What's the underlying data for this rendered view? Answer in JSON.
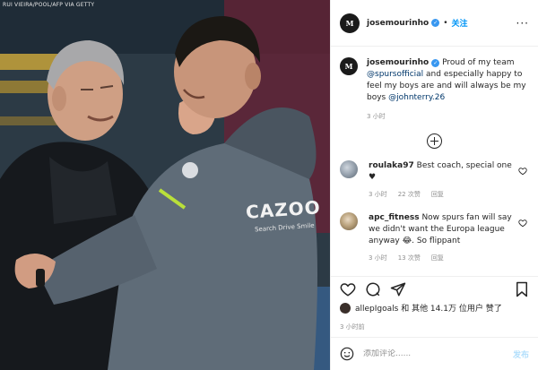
{
  "photo": {
    "credit": "RUI VIEIRA/POOL/AFP VIA GETTY",
    "jacket_brand": "CAZOO",
    "jacket_tagline": "Search Drive Smile"
  },
  "header": {
    "avatar_text": "M",
    "username": "josemourinho",
    "follow_label": "关注",
    "more_label": "···"
  },
  "caption": {
    "username": "josemourinho",
    "text_1": "Proud of my team",
    "mention_1": "@spursofficial",
    "text_2": "and especially happy to feel my boys are and will always be my boys",
    "mention_2": "@johnterry.26",
    "time": "3 小时"
  },
  "comments": [
    {
      "username": "roulaka97",
      "text": "Best coach, special one ♥",
      "time": "3 小时",
      "likes": "22 次赞",
      "reply": "回复"
    },
    {
      "username": "apc_fitness",
      "text": "Now spurs fan will say we didn't want the Europa league anyway 😂. So flippant",
      "time": "3 小时",
      "likes": "13 次赞",
      "reply": "回复"
    }
  ],
  "likes": {
    "text": "allepIgoals 和 其他 14.1万 位用户 赞了"
  },
  "post_time": "3 小时前",
  "add_comment": {
    "placeholder": "添加评论......",
    "post_label": "发布"
  },
  "colors": {
    "link": "#00376b",
    "accent": "#0095f6",
    "verified": "#3897f0"
  }
}
